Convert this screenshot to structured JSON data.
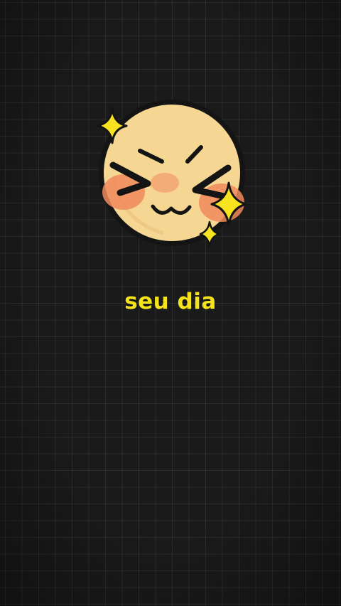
{
  "caption": {
    "text": "seu dia",
    "color": "#f4e21b"
  },
  "emoji": {
    "icon": "blushing-squinting-face-with-sparkles",
    "face_color": "#f6d693",
    "blush_color": "#f08a5d",
    "outline_color": "#141414",
    "sparkle_color": "#f7e320"
  },
  "background": {
    "color": "#1a1a1a",
    "pattern": "grid"
  }
}
